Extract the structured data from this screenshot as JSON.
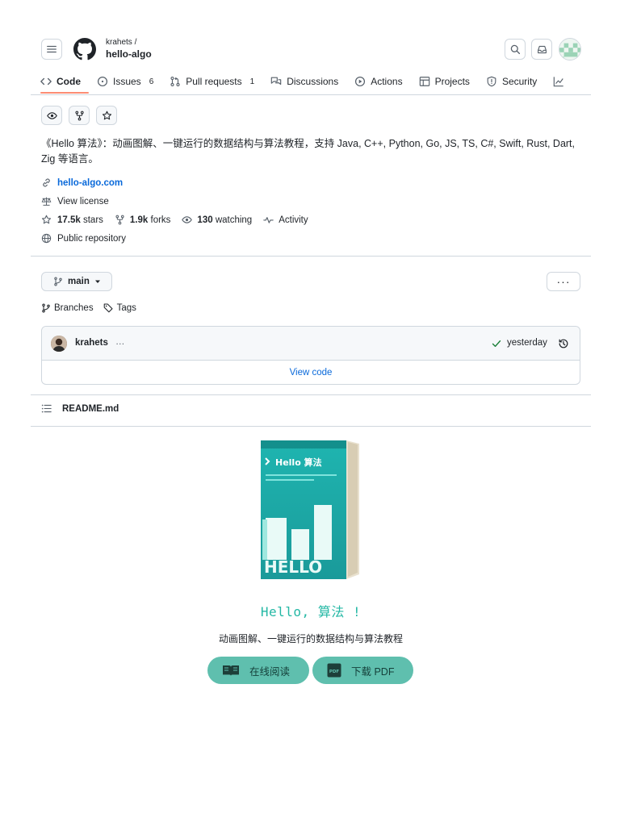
{
  "header": {
    "owner": "krahets /",
    "repo": "hello-algo"
  },
  "nav": {
    "items": [
      {
        "label": "Code",
        "count": ""
      },
      {
        "label": "Issues",
        "count": "6"
      },
      {
        "label": "Pull requests",
        "count": "1"
      },
      {
        "label": "Discussions",
        "count": ""
      },
      {
        "label": "Actions",
        "count": ""
      },
      {
        "label": "Projects",
        "count": ""
      },
      {
        "label": "Security",
        "count": ""
      }
    ]
  },
  "about": {
    "description": "《Hello 算法》：动画图解、一键运行的数据结构与算法教程，支持 Java, C++, Python, Go, JS, TS, C#, Swift, Rust, Dart, Zig 等语言。",
    "website": "hello-algo.com",
    "license": "View license",
    "stars_count": "17.5k",
    "stars_label": "stars",
    "forks_count": "1.9k",
    "forks_label": "forks",
    "watching_count": "130",
    "watching_label": "watching",
    "activity": "Activity",
    "visibility": "Public repository"
  },
  "code": {
    "branch": "main",
    "more": "···",
    "branches": "Branches",
    "tags": "Tags",
    "commit_author": "krahets",
    "commit_message": "…",
    "commit_time": "yesterday",
    "view_code": "View code"
  },
  "readme": {
    "filename": "README.md",
    "book_title": "Hello 算法",
    "cover_word": "HELLO",
    "title": "Hello, 算法 !",
    "subtitle": "动画图解、一键运行的数据结构与算法教程",
    "read_online": "在线阅读",
    "download_pdf": "下载 PDF"
  },
  "colors": {
    "accent_link": "#0969da",
    "nav_underline": "#fd8c73",
    "readme_title": "#25b8a5",
    "pill": "#5fbfae"
  }
}
